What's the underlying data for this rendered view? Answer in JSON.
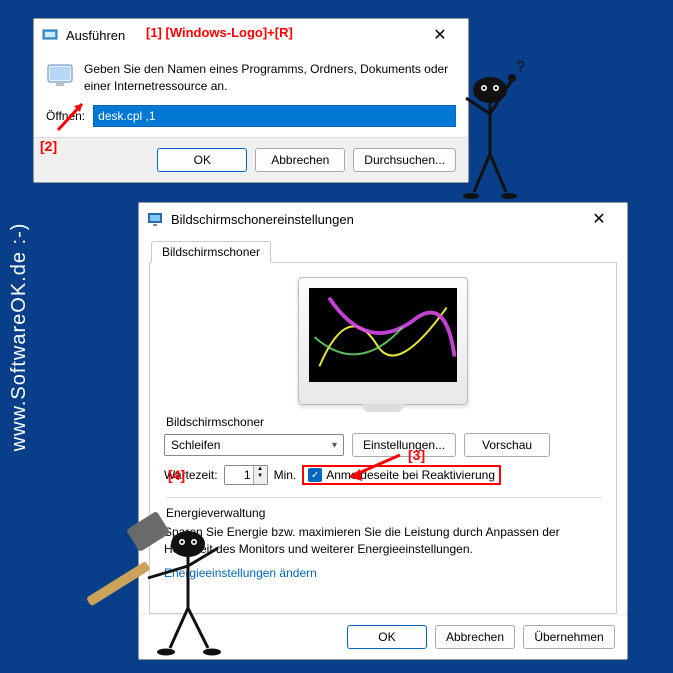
{
  "watermark": "www.SoftwareOK.de :-)",
  "annotations": {
    "a1": "[1]   [Windows-Logo]+[R]",
    "a2": "[2]",
    "a3": "[3]",
    "a4": "[4]"
  },
  "run": {
    "title": "Ausführen",
    "desc": "Geben Sie den Namen eines Programms, Ordners, Dokuments oder einer Internetressource an.",
    "open_label": "Öffnen:",
    "input_value": "desk.cpl ,1",
    "ok": "OK",
    "cancel": "Abbrechen",
    "browse": "Durchsuchen..."
  },
  "ss": {
    "title": "Bildschirmschonereinstellungen",
    "tab": "Bildschirmschoner",
    "group_label": "Bildschirmschoner",
    "combo_value": "Schleifen",
    "settings_btn": "Einstellungen...",
    "preview_btn": "Vorschau",
    "wait_label": "Wartezeit:",
    "wait_value": "1",
    "wait_unit": "Min.",
    "checkbox_label": "Anmeldeseite bei Reaktivierung",
    "energy_label": "Energieverwaltung",
    "energy_desc": "Sparen Sie Energie bzw. maximieren Sie die Leistung durch Anpassen der Helligkeit des Monitors und weiterer Energieeinstellungen.",
    "energy_link": "Energieeinstellungen ändern",
    "ok": "OK",
    "cancel": "Abbrechen",
    "apply": "Übernehmen"
  }
}
